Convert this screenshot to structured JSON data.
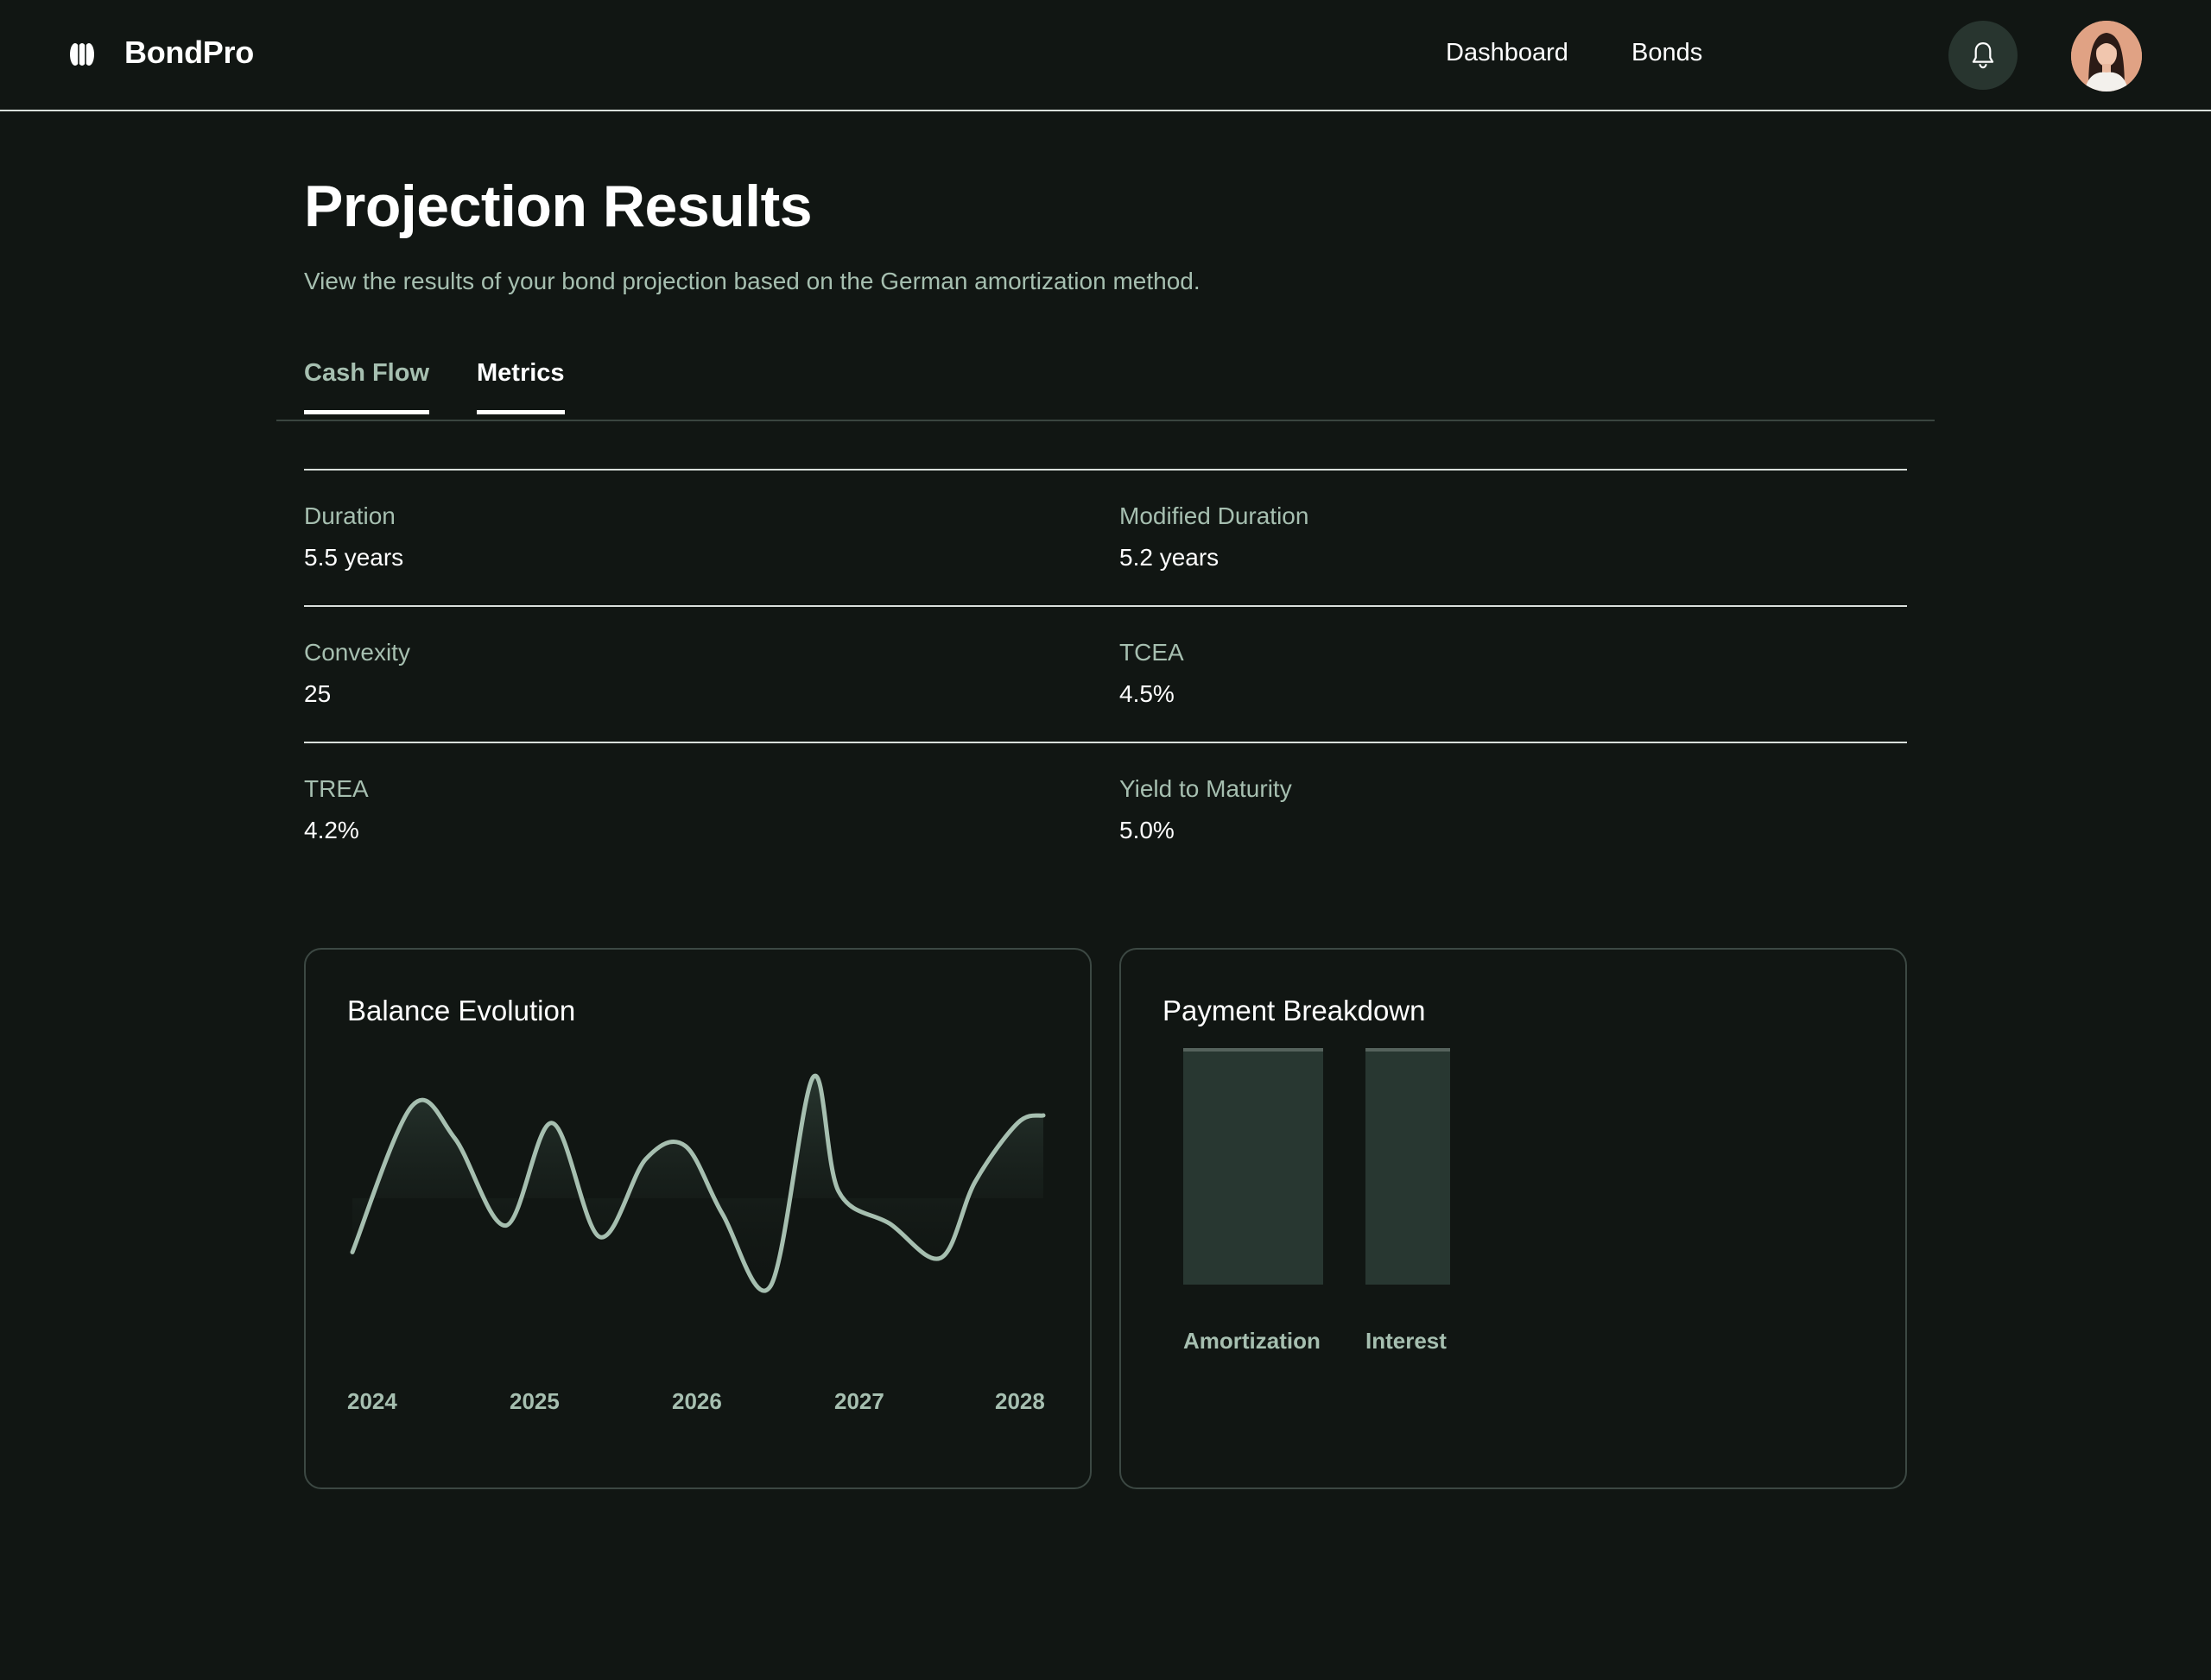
{
  "header": {
    "brand": "BondPro",
    "nav": {
      "dashboard": "Dashboard",
      "bonds": "Bonds"
    }
  },
  "page": {
    "title": "Projection Results",
    "subtitle": "View the results of your bond projection based on the German amortization method."
  },
  "tabs": [
    {
      "label": "Cash Flow"
    },
    {
      "label": "Metrics",
      "active": true
    }
  ],
  "metrics": [
    {
      "label": "Duration",
      "value": "5.5 years"
    },
    {
      "label": "Modified Duration",
      "value": "5.2 years"
    },
    {
      "label": "Convexity",
      "value": "25"
    },
    {
      "label": "TCEA",
      "value": "4.5%"
    },
    {
      "label": "TREA",
      "value": "4.2%"
    },
    {
      "label": "Yield to Maturity",
      "value": "5.0%"
    }
  ],
  "colors": {
    "background": "#111613",
    "accent_text": "#a6bfb0",
    "line": "#a6bfb0",
    "bar_fill": "#283731"
  },
  "chart_data": [
    {
      "type": "line",
      "title": "Balance Evolution",
      "x_ticks": [
        "2024",
        "2025",
        "2026",
        "2027",
        "2028"
      ],
      "x": [
        2024.0,
        2024.35,
        2024.6,
        2024.9,
        2025.17,
        2025.45,
        2025.72,
        2025.95,
        2026.17,
        2026.45,
        2026.7,
        2026.85,
        2027.15,
        2027.45,
        2027.65,
        2027.9,
        2028.05
      ],
      "values": [
        0.18,
        0.95,
        0.78,
        0.32,
        0.86,
        0.26,
        0.67,
        0.74,
        0.38,
        0.0,
        1.1,
        0.5,
        0.33,
        0.15,
        0.55,
        0.86,
        0.9
      ],
      "xlabel": "",
      "ylabel": "",
      "grid": false,
      "legend": "none"
    },
    {
      "type": "bar",
      "title": "Payment Breakdown",
      "categories": [
        "Amortization",
        "Interest"
      ],
      "values": [
        1,
        1
      ],
      "grid": false,
      "legend": "none"
    }
  ]
}
